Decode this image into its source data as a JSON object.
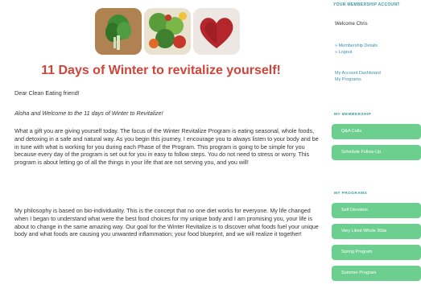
{
  "page": {
    "title": "11 Days of Winter to revitalize yourself!",
    "greeting": "Dear Clean Eating friend!",
    "intro": "Aloha and Welcome to the 11 days of Winter to Revitalize!",
    "paragraph1": "What a gift you are giving yourself today. The focus of the Winter Revitalize Program is eating seasonal, whole foods, and detoxing in a safe and natural way. As you begin this journey, I encourage you to always listen to your body and be in tune with what is working for you during each Phase of the Program. This program is going to be simple for you because every day of the program is set out for you in easy to follow steps. You do not need to stress or worry. This program is about letting go of all the things in your life that are not serving you, and you will!",
    "paragraph2": "My philosophy is based on bio-individuality. This is the concept that no one diet works for everyone. My life changed when I began to understand what were the best food choices for my unique body and I am promising you, your life is about to change in the same amazing way. Our goal for the Winter Revitalize is to discover what foods fuel your unique body and what foods are causing you unwanted inflammation; your food blueprint, and we will realize it together!"
  },
  "sidebar": {
    "account_title": "YOUR MEMBERSHIP ACCOUNT",
    "welcome": "Welcome Chris",
    "links": [
      "» Membership Details",
      "» Logout",
      "My Account Dashboard",
      "My Programs"
    ],
    "membership_heading": "MY MEMBERSHIP",
    "membership_buttons": [
      "Q&A Calls",
      "Schedule Follow-Up"
    ],
    "programs_heading": "MY PROGRAMS",
    "program_buttons": [
      "Self Devotion",
      "Very Liked Whole 30ds",
      "Spring Program",
      "Summer Program"
    ]
  },
  "colors": {
    "title": "#d0443a",
    "accent": "#3a9aa2",
    "button": "#6ccf90"
  },
  "icons": [
    "greens-image",
    "salad-image",
    "heart-berries-image"
  ]
}
